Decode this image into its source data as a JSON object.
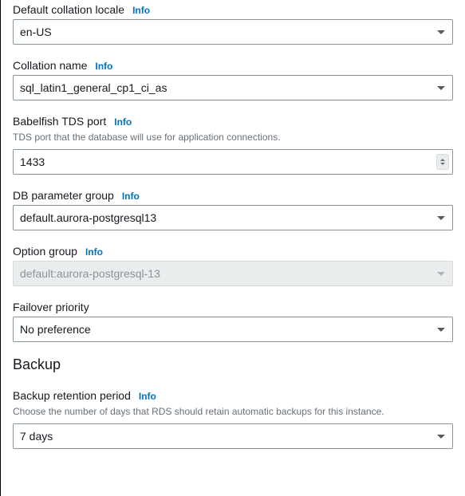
{
  "info_label": "Info",
  "fields": {
    "collation_locale": {
      "label": "Default collation locale",
      "value": "en-US"
    },
    "collation_name": {
      "label": "Collation name",
      "value": "sql_latin1_general_cp1_ci_as"
    },
    "tds_port": {
      "label": "Babelfish TDS port",
      "helper": "TDS port that the database will use for application connections.",
      "value": "1433"
    },
    "db_param_group": {
      "label": "DB parameter group",
      "value": "default.aurora-postgresql13"
    },
    "option_group": {
      "label": "Option group",
      "value": "default:aurora-postgresql-13"
    },
    "failover_priority": {
      "label": "Failover priority",
      "value": "No preference"
    },
    "backup_retention": {
      "label": "Backup retention period",
      "helper": "Choose the number of days that RDS should retain automatic backups for this instance.",
      "value": "7 days"
    }
  },
  "sections": {
    "backup": "Backup"
  }
}
